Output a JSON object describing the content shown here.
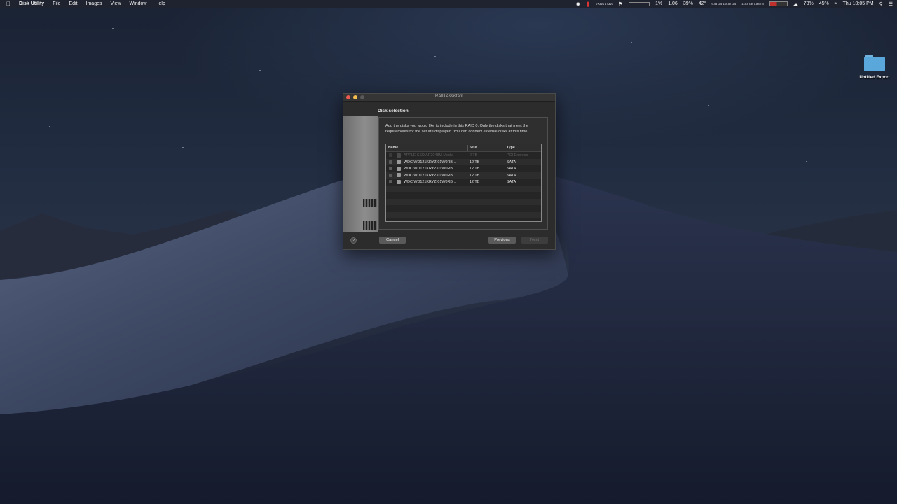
{
  "menubar": {
    "app_name": "Disk Utility",
    "menus": [
      "File",
      "Edit",
      "Images",
      "View",
      "Window",
      "Help"
    ],
    "status": {
      "net_up": "0 KB/s",
      "net_down": "1 KB/s",
      "cpu": "1%",
      "load": "1.06",
      "percent_a": "39%",
      "temp": "42°",
      "disk_a_top": "9.48 GB",
      "disk_a_bottom": "118.52 GB",
      "disk_b_top": "113.4 GB",
      "disk_b_bottom": "1.88 TB",
      "battery_a": "78%",
      "battery_b": "45%",
      "clock": "Thu 10:05 PM"
    }
  },
  "desktop": {
    "folder_label": "Untitled Export"
  },
  "window": {
    "title": "RAID Assistant",
    "heading": "Disk selection",
    "description": "Add the disks you would like to include in this RAID 0. Only the disks that meet the requirements for the set are displayed. You can connect external disks at this time.",
    "columns": {
      "name": "Name",
      "size": "Size",
      "type": "Type"
    },
    "disks": [
      {
        "name": "APPLE SSD AP2048M Media",
        "size": "2 TB",
        "type": "PCI-Express",
        "dimmed": true
      },
      {
        "name": "WDC WD121KRYZ-01W0RB...",
        "size": "12 TB",
        "type": "SATA",
        "dimmed": false
      },
      {
        "name": "WDC WD121KRYZ-01W0RB...",
        "size": "12 TB",
        "type": "SATA",
        "dimmed": false
      },
      {
        "name": "WDC WD121KRYZ-01W0RB...",
        "size": "12 TB",
        "type": "SATA",
        "dimmed": false
      },
      {
        "name": "WDC WD121KRYZ-01W0RB...",
        "size": "12 TB",
        "type": "SATA",
        "dimmed": false
      }
    ],
    "help_label": "?",
    "cancel_label": "Cancel",
    "previous_label": "Previous",
    "next_label": "Next"
  }
}
